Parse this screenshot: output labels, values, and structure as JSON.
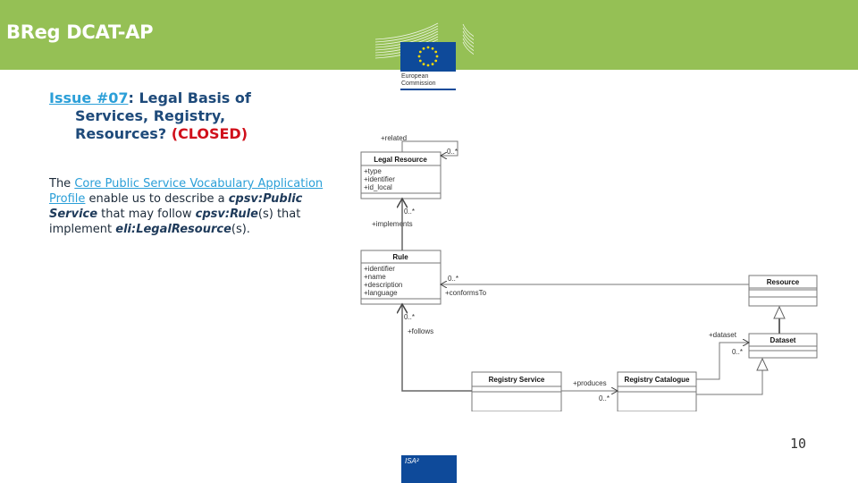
{
  "header": {
    "title": "BReg DCAT-AP",
    "logo": {
      "line1": "European",
      "line2": "Commission"
    },
    "brand_color": "#95c055"
  },
  "issue": {
    "link_text": "Issue #07",
    "title_rest_1": ": Legal Basis of",
    "title_line2": "Services, Registry,",
    "title_line3": "Resources?",
    "status": "(CLOSED)",
    "status_color": "#d0101b"
  },
  "body": {
    "intro": "The ",
    "link_text": "Core Public Service Vocabulary Application Profile",
    "after_link": " enable us to describe a ",
    "term1": "cpsv:Public Service",
    "mid1": " that may follow ",
    "term2": "cpsv:Rule",
    "mid2": "(s) that implement ",
    "term3": "eli:LegalResource",
    "end": "(s)."
  },
  "diagram": {
    "classes": {
      "legal_resource": {
        "name": "Legal Resource",
        "attributes": [
          "+type",
          "+identifier",
          "+id_local"
        ]
      },
      "rule": {
        "name": "Rule",
        "attributes": [
          "+identifier",
          "+name",
          "+description",
          "+language"
        ]
      },
      "resource": {
        "name": "Resource",
        "attributes": []
      },
      "dataset": {
        "name": "Dataset",
        "attributes": []
      },
      "registry_service": {
        "name": "Registry Service",
        "attributes": []
      },
      "registry_catalogue": {
        "name": "Registry Catalogue",
        "attributes": []
      }
    },
    "labels": {
      "related": "+related",
      "related_mult": "0..*",
      "implements": "+implements",
      "implements_mult": "0..*",
      "conforms_to": "+conformsTo",
      "conforms_mult": "0..*",
      "follows": "+follows",
      "follows_mult": "0..*",
      "dataset": "+dataset",
      "dataset_mult": "0..*",
      "produces": "+produces",
      "produces_mult": "0..*"
    }
  },
  "footer": {
    "page_number": "10",
    "isa_logo": "ISA²"
  }
}
